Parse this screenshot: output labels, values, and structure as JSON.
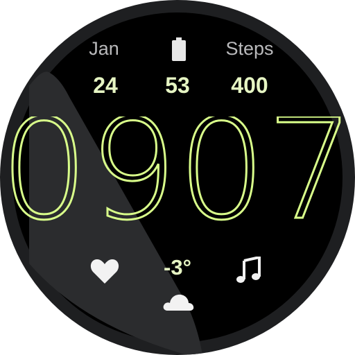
{
  "complications": {
    "date": {
      "label": "Jan",
      "value": "24"
    },
    "battery": {
      "icon": "battery-icon",
      "value": "53"
    },
    "steps": {
      "label": "Steps",
      "value": "400"
    }
  },
  "time": {
    "hours": "09",
    "minutes": "07",
    "display": "0907"
  },
  "weather": {
    "temperature": "-3°",
    "icon": "cloud-icon"
  },
  "bottom": {
    "left_icon": "heart-icon",
    "right_icon": "music-note-icon"
  },
  "colors": {
    "background": "#000000",
    "bezel": "#1e1f21",
    "accent": "#d9ff8a",
    "value_text": "#e6f5c3",
    "label_text": "#b9b9bb"
  }
}
